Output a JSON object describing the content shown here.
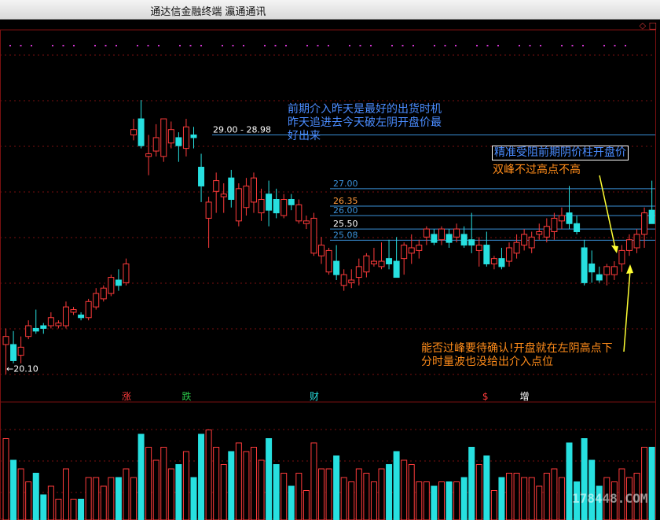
{
  "window": {
    "title": "通达信金融终端  瀛通通讯"
  },
  "annotations": {
    "note_blue": [
      "前期介入昨天是最好的出货时机",
      "昨天追进去今天破左阴开盘价最",
      "好出来"
    ],
    "note_box": "精准受阻前期阴价柱开盘价",
    "note_orange1": "双峰不过高点不高",
    "note_orange2": [
      "能否过峰要待确认!开盘就在左阴高点下",
      "分时量波也没给出介入点位"
    ]
  },
  "watermark": "178448.COM",
  "corner_icons": "◇ □",
  "colors": {
    "up": "#ff3b3b",
    "down": "#27e0e0",
    "line": "#3a8fd6",
    "grid": "#7a1010",
    "label_white": "#ffffff",
    "label_orange": "#ff9a3c",
    "arrow": "#ffff33"
  },
  "chart_data": {
    "type": "candlestick",
    "y_axis": {
      "min": 19.5,
      "max": 32.5
    },
    "price_labels": [
      {
        "text": "29.00 - 28.98",
        "y": 29.0,
        "color": "#ffffff"
      },
      {
        "text": "27.00",
        "y": 27.0,
        "color": "#3a8fd6"
      },
      {
        "text": "26.35",
        "y": 26.35,
        "color": "#ff9a3c"
      },
      {
        "text": "26.00",
        "y": 26.0,
        "color": "#3a8fd6"
      },
      {
        "text": "25.50",
        "y": 25.5,
        "color": "#ffffff"
      },
      {
        "text": "25.08",
        "y": 25.08,
        "color": "#3a8fd6"
      },
      {
        "text": "20.10",
        "y": 20.1,
        "color": "#ffffff"
      }
    ],
    "event_tags": [
      {
        "text": "涨",
        "index": 16,
        "color": "#ff3b3b"
      },
      {
        "text": "跌",
        "index": 24,
        "color": "#2cc94a"
      },
      {
        "text": "财",
        "index": 41,
        "color": "#27e0e0"
      },
      {
        "text": "$",
        "index": 64,
        "color": "#ff3b3b"
      },
      {
        "text": "增",
        "index": 69,
        "color": "#ffffff"
      }
    ],
    "candles": [
      [
        21.2,
        21.8,
        20.1,
        21.5
      ],
      [
        21.2,
        21.7,
        20.5,
        20.6
      ],
      [
        20.8,
        21.5,
        20.5,
        21.1
      ],
      [
        21.5,
        22.1,
        21.4,
        21.9
      ],
      [
        21.8,
        22.5,
        21.6,
        21.7
      ],
      [
        21.9,
        22.0,
        21.6,
        21.8
      ],
      [
        21.9,
        22.4,
        21.8,
        22.2
      ],
      [
        21.9,
        22.1,
        21.8,
        22.0
      ],
      [
        21.9,
        22.8,
        21.8,
        22.6
      ],
      [
        22.4,
        22.6,
        22.3,
        22.5
      ],
      [
        22.3,
        22.4,
        22.1,
        22.2
      ],
      [
        22.2,
        22.9,
        22.1,
        22.8
      ],
      [
        22.6,
        23.3,
        22.5,
        23.1
      ],
      [
        22.9,
        23.4,
        22.8,
        23.3
      ],
      [
        23.1,
        23.8,
        23.0,
        23.7
      ],
      [
        23.6,
        24.0,
        23.2,
        23.4
      ],
      [
        23.5,
        24.4,
        23.4,
        24.2
      ],
      [
        29.0,
        29.6,
        28.8,
        29.2
      ],
      [
        29.6,
        30.3,
        28.5,
        28.6
      ],
      [
        28.2,
        29.0,
        27.5,
        28.3
      ],
      [
        28.4,
        29.4,
        28.2,
        28.9
      ],
      [
        28.2,
        29.5,
        28.0,
        29.6
      ],
      [
        28.7,
        29.5,
        28.5,
        29.2
      ],
      [
        28.9,
        29.1,
        28.0,
        28.6
      ],
      [
        28.5,
        29.6,
        28.2,
        29.3
      ],
      [
        29.0,
        29.3,
        28.5,
        28.9
      ],
      [
        27.8,
        28.3,
        26.5,
        27.1
      ],
      [
        25.9,
        26.7,
        24.8,
        26.5
      ],
      [
        26.9,
        27.6,
        26.1,
        27.3
      ],
      [
        26.7,
        27.2,
        26.1,
        26.8
      ],
      [
        27.4,
        27.7,
        26.3,
        26.6
      ],
      [
        25.8,
        27.2,
        25.6,
        27.0
      ],
      [
        26.3,
        27.4,
        26.0,
        27.1
      ],
      [
        26.5,
        27.6,
        26.1,
        27.4
      ],
      [
        26.1,
        27.0,
        25.8,
        26.6
      ],
      [
        26.8,
        27.3,
        25.6,
        26.2
      ],
      [
        26.6,
        27.0,
        25.9,
        26.1
      ],
      [
        26.0,
        26.8,
        25.9,
        26.6
      ],
      [
        26.6,
        26.8,
        26.2,
        26.4
      ],
      [
        25.8,
        26.6,
        25.7,
        26.4
      ],
      [
        25.7,
        26.0,
        25.5,
        25.8
      ],
      [
        24.6,
        26.1,
        24.5,
        25.9
      ],
      [
        24.5,
        25.2,
        24.2,
        24.9
      ],
      [
        23.9,
        24.8,
        23.8,
        24.7
      ],
      [
        24.3,
        24.9,
        23.6,
        23.8
      ],
      [
        23.4,
        24.0,
        23.2,
        23.8
      ],
      [
        23.5,
        24.0,
        23.3,
        23.6
      ],
      [
        23.7,
        24.4,
        23.4,
        24.1
      ],
      [
        23.9,
        24.6,
        23.7,
        24.5
      ],
      [
        24.2,
        24.8,
        24.1,
        24.3
      ],
      [
        24.1,
        25.0,
        24.0,
        24.3
      ],
      [
        24.4,
        25.1,
        24.0,
        24.2
      ],
      [
        24.3,
        25.2,
        23.8,
        23.7
      ],
      [
        24.4,
        25.0,
        23.8,
        24.9
      ],
      [
        24.6,
        25.3,
        24.2,
        24.8
      ],
      [
        24.7,
        25.1,
        24.4,
        24.9
      ],
      [
        25.2,
        25.6,
        24.9,
        25.5
      ],
      [
        25.3,
        25.5,
        24.9,
        25.0
      ],
      [
        25.1,
        25.6,
        24.9,
        25.5
      ],
      [
        25.3,
        25.5,
        24.8,
        25.0
      ],
      [
        25.2,
        25.7,
        25.0,
        25.5
      ],
      [
        25.3,
        25.6,
        24.8,
        24.9
      ],
      [
        25.1,
        26.1,
        24.6,
        24.9
      ],
      [
        24.7,
        25.2,
        24.1,
        24.9
      ],
      [
        24.9,
        25.4,
        24.1,
        24.2
      ],
      [
        24.2,
        24.5,
        24.0,
        24.4
      ],
      [
        24.4,
        24.8,
        24.0,
        24.1
      ],
      [
        24.3,
        25.0,
        24.1,
        24.8
      ],
      [
        24.6,
        25.3,
        24.4,
        25.0
      ],
      [
        24.9,
        25.5,
        24.7,
        25.3
      ],
      [
        24.8,
        25.4,
        24.6,
        25.2
      ],
      [
        25.3,
        25.7,
        25.1,
        25.4
      ],
      [
        25.2,
        25.9,
        25.0,
        25.6
      ],
      [
        25.4,
        26.1,
        25.1,
        25.9
      ],
      [
        25.8,
        26.3,
        25.5,
        26.0
      ],
      [
        26.1,
        27.1,
        25.5,
        25.7
      ],
      [
        25.7,
        26.0,
        25.3,
        25.4
      ],
      [
        24.8,
        25.1,
        23.4,
        23.5
      ],
      [
        24.2,
        24.7,
        23.5,
        23.9
      ],
      [
        23.8,
        24.1,
        23.5,
        23.6
      ],
      [
        23.8,
        24.2,
        23.4,
        24.1
      ],
      [
        23.8,
        24.3,
        23.6,
        24.1
      ],
      [
        24.2,
        24.9,
        23.9,
        24.7
      ],
      [
        24.7,
        25.3,
        24.5,
        25.1
      ],
      [
        24.8,
        25.5,
        24.6,
        25.3
      ],
      [
        25.3,
        26.3,
        24.8,
        26.1
      ],
      [
        26.2,
        27.3,
        25.8,
        25.7
      ]
    ]
  }
}
